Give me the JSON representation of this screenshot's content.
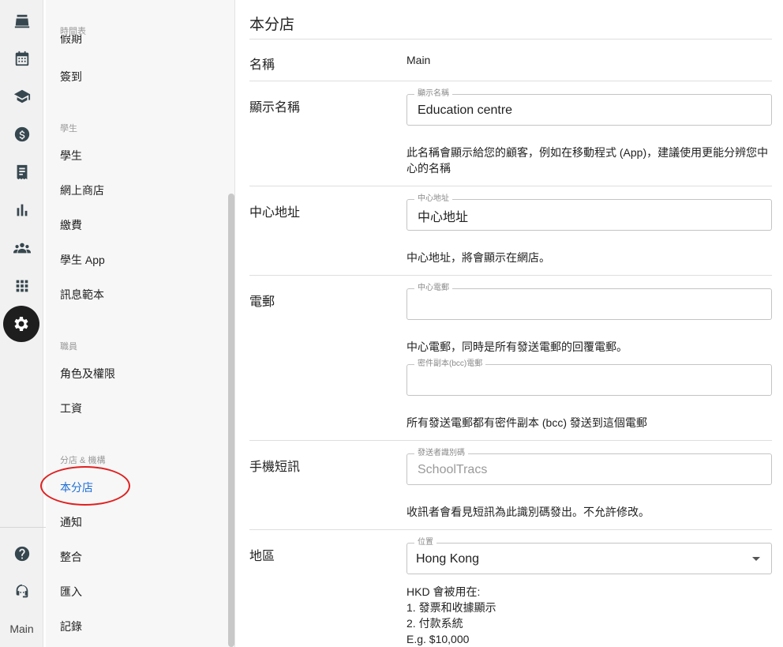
{
  "rail": {
    "icons": [
      "cash-register-icon",
      "calendar-icon",
      "graduation-cap-icon",
      "dollar-icon",
      "receipt-icon",
      "bar-chart-icon",
      "group-icon",
      "apps-grid-icon",
      "settings-icon"
    ],
    "bottom_icons": [
      "help-icon",
      "support-agent-icon"
    ],
    "branch": "Main"
  },
  "subnav": {
    "sections": {
      "timetable": "時間表",
      "students": "學生",
      "staff": "職員",
      "branch": "分店 & 機構"
    },
    "clipped_item": "假期",
    "items": {
      "check_in": "簽到",
      "students": "學生",
      "online_shop": "網上商店",
      "payment": "繳費",
      "student_app": "學生 App",
      "message_template": "訊息範本",
      "roles": "角色及權限",
      "payroll": "工資",
      "this_branch": "本分店",
      "notifications": "通知",
      "integration": "整合",
      "import": "匯入",
      "log": "記錄"
    }
  },
  "main": {
    "title": "本分店",
    "name_row": {
      "label": "名稱",
      "value": "Main"
    },
    "display_name": {
      "label": "顯示名稱",
      "field_label": "顯示名稱",
      "value": "Education centre",
      "help": "此名稱會顯示給您的顧客，例如在移動程式 (App)，建議使用更能分辨您中心的名稱"
    },
    "address": {
      "label": "中心地址",
      "field_label": "中心地址",
      "value": "中心地址",
      "help": "中心地址，將會顯示在網店。"
    },
    "email": {
      "label": "電郵",
      "field_label": "中心電郵",
      "value": "",
      "help": "中心電郵，同時是所有發送電郵的回覆電郵。",
      "bcc_field_label": "密件副本(bcc)電郵",
      "bcc_value": "",
      "bcc_help": "所有發送電郵都有密件副本 (bcc) 發送到這個電郵"
    },
    "sms": {
      "label": "手機短訊",
      "field_label": "發送者識別碼",
      "value": "SchoolTracs",
      "help": "收訊者會看見短訊為此識別碼發出。不允許修改。"
    },
    "region": {
      "label": "地區",
      "field_label": "位置",
      "value": "Hong Kong",
      "help_lines": [
        "HKD 會被用在:",
        "1. 發票和收據顯示",
        "2. 付款系統",
        "E.g. $10,000"
      ]
    }
  }
}
